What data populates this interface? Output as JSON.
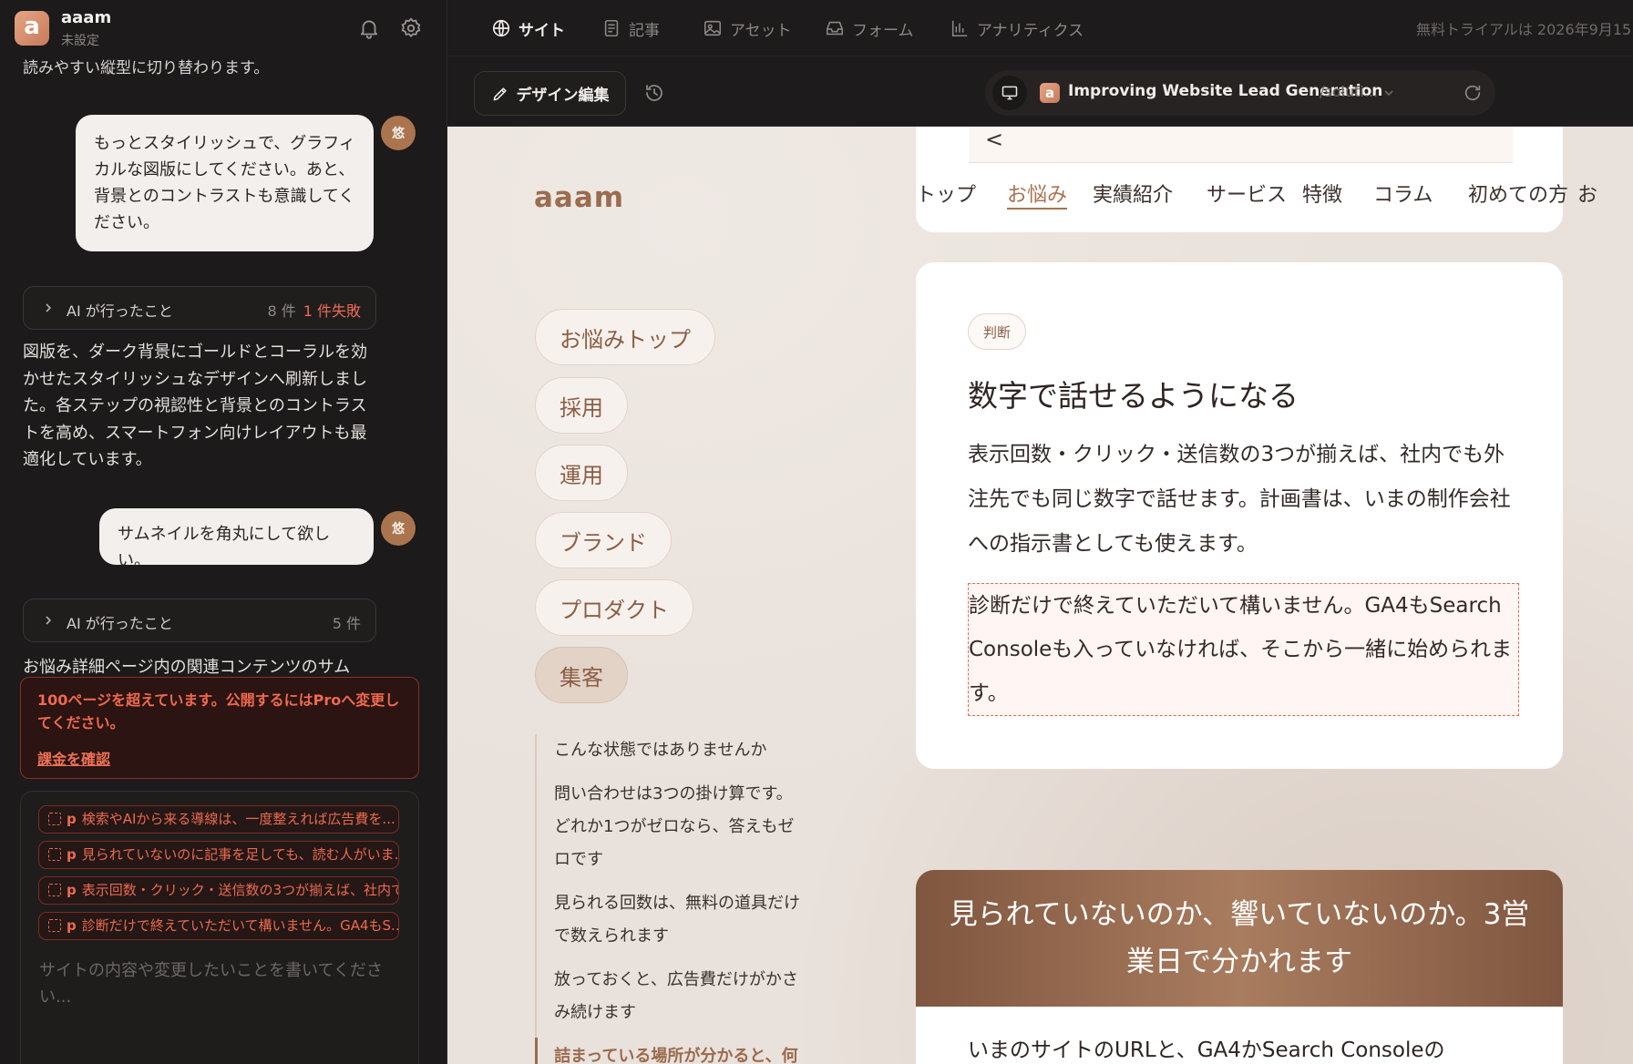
{
  "app": {
    "name": "aaam",
    "status": "未設定",
    "logo_letter": "a"
  },
  "chat": {
    "cut_text": "読みやすい縦型に切り替わります。",
    "user_msg_1": "もっとスタイリッシュで、グラフィカルな図版にしてください。あと、背景とのコントラストも意識してください。",
    "user_avatar": "悠",
    "ai_summary_1": {
      "label": "AI が行ったこと",
      "count": "8 件",
      "failed": "1 件失敗"
    },
    "ai_text_1": "図版を、ダーク背景にゴールドとコーラルを効かせたスタイリッシュなデザインへ刷新しました。各ステップの視認性と背景とのコントラストを高め、スマートフォン向けレイアウトも最適化しています。",
    "user_msg_2": "サムネイルを角丸にして欲しい。",
    "ai_summary_2": {
      "label": "AI が行ったこと",
      "count": "5 件"
    },
    "ai_text_2": "お悩み詳細ページ内の関連コンテンツのサム",
    "warning": {
      "text": "100ページを超えています。公開するにはProへ変更してください。",
      "link": "課金を確認"
    },
    "chips": [
      {
        "tag": "p",
        "text": "検索やAIから来る導線は、一度整えれば広告費を..."
      },
      {
        "tag": "p",
        "text": "見られていないのに記事を足しても、読む人がいま..."
      },
      {
        "tag": "p",
        "text": "表示回数・クリック・送信数の3つが揃えば、社内で..."
      },
      {
        "tag": "p",
        "text": "診断だけで終えていただいて構いません。GA4もS..."
      }
    ],
    "input_placeholder": "サイトの内容や変更したいことを書いてください..."
  },
  "topnav": {
    "tabs": [
      {
        "label": "サイト",
        "icon": "globe-icon",
        "active": true
      },
      {
        "label": "記事",
        "icon": "document-icon",
        "active": false
      },
      {
        "label": "アセット",
        "icon": "image-icon",
        "active": false
      },
      {
        "label": "フォーム",
        "icon": "inbox-icon",
        "active": false
      },
      {
        "label": "アナリティクス",
        "icon": "bar-chart-icon",
        "active": false
      }
    ],
    "trial": "無料トライアルは 2026年9月15日"
  },
  "toolbar": {
    "design_label": "デザイン編集",
    "page_title": "Improving Website Lead Generation",
    "page_path": "/soluti...",
    "favicon_letter": "a"
  },
  "site": {
    "logo": "aaam",
    "back": "<",
    "global_nav": [
      "トップ",
      "お悩み",
      "実績紹介",
      "サービス",
      "特徴",
      "コラム",
      "初めての方",
      "お"
    ],
    "categories": [
      "お悩みトップ",
      "採用",
      "運用",
      "ブランド",
      "プロダクト",
      "集客"
    ],
    "toc": [
      "こんな状態ではありませんか",
      "問い合わせは3つの掛け算です。どれか1つがゼロなら、答えもゼロです",
      "見られる回数は、無料の道具だけで数えられます",
      "放っておくと、広告費だけがかさみ続けます",
      "詰まっている場所が分かると、何"
    ],
    "card": {
      "badge": "判断",
      "heading": "数字で話せるようになる",
      "body": "表示回数・クリック・送信数の3つが揃えば、社内でも外注先でも同じ数字で話せます。計画書は、いまの制作会社への指示書としても使えます。",
      "note": "診断だけで終えていただいて構いません。GA4もSearch Consoleも入っていなければ、そこから一緒に始められます。"
    },
    "cta": {
      "title": "見られていないのか、響いていないのか。3営業日で分かれます",
      "body": "いまのサイトのURLと、GA4かSearch Consoleの"
    }
  },
  "colors": {
    "accent": "#a8734f",
    "danger": "#f06a55",
    "sidebar_bg": "#1c1a1a"
  }
}
